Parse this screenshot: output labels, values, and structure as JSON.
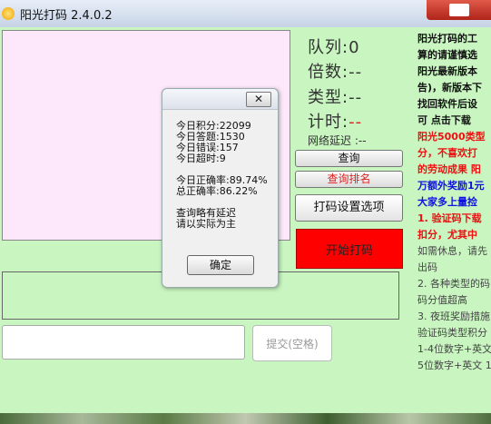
{
  "window": {
    "title": "阳光打码 2.4.0.2",
    "icon": "sun-icon"
  },
  "stats": {
    "queue_label": "队列:",
    "queue_value": "0",
    "multiplier_label": "倍数:",
    "multiplier_value": "--",
    "type_label": "类型:",
    "type_value": "--",
    "timer_label": "计时:",
    "timer_value": "--",
    "net_delay": "网络延迟 :--"
  },
  "buttons": {
    "query": "查询",
    "query_rank": "查询排名",
    "settings": "打码设置选项",
    "start": "开始打码",
    "submit": "提交(空格)"
  },
  "answer_input": {
    "value": "",
    "placeholder": ""
  },
  "info_lines": [
    "阳光打码的工",
    "算的请谨慎选",
    "阳光最新版本",
    "告)，新版本下",
    "找回软件后设",
    "可  点击下载",
    "阳光5000类型",
    "分，不喜欢打",
    "的劳动成果  阳",
    "万额外奖励1元",
    "大家多上量捡",
    "1. 验证码下载",
    "扣分，尤其中",
    "如需休息，请先",
    "出码",
    "2. 各种类型的码",
    "码分值超高",
    "3. 夜班奖励措施",
    "验证码类型积分",
    "1-4位数字+英文",
    "5位数字+英文  1"
  ],
  "dialog": {
    "close_label": "✕",
    "score": "今日积分:22099",
    "answered": "今日答题:1530",
    "errors": "今日错误:157",
    "timeouts": "今日超时:9",
    "today_accuracy": "今日正确率:89.74%",
    "total_accuracy": "总正确率:86.22%",
    "note1": "查询略有延迟",
    "note2": "请以实际为主",
    "ok": "确定"
  },
  "colors": {
    "background": "#c8f5c0",
    "canvas": "#fde8fb",
    "start_button": "#ff0000",
    "highlight_red": "#e02020"
  }
}
